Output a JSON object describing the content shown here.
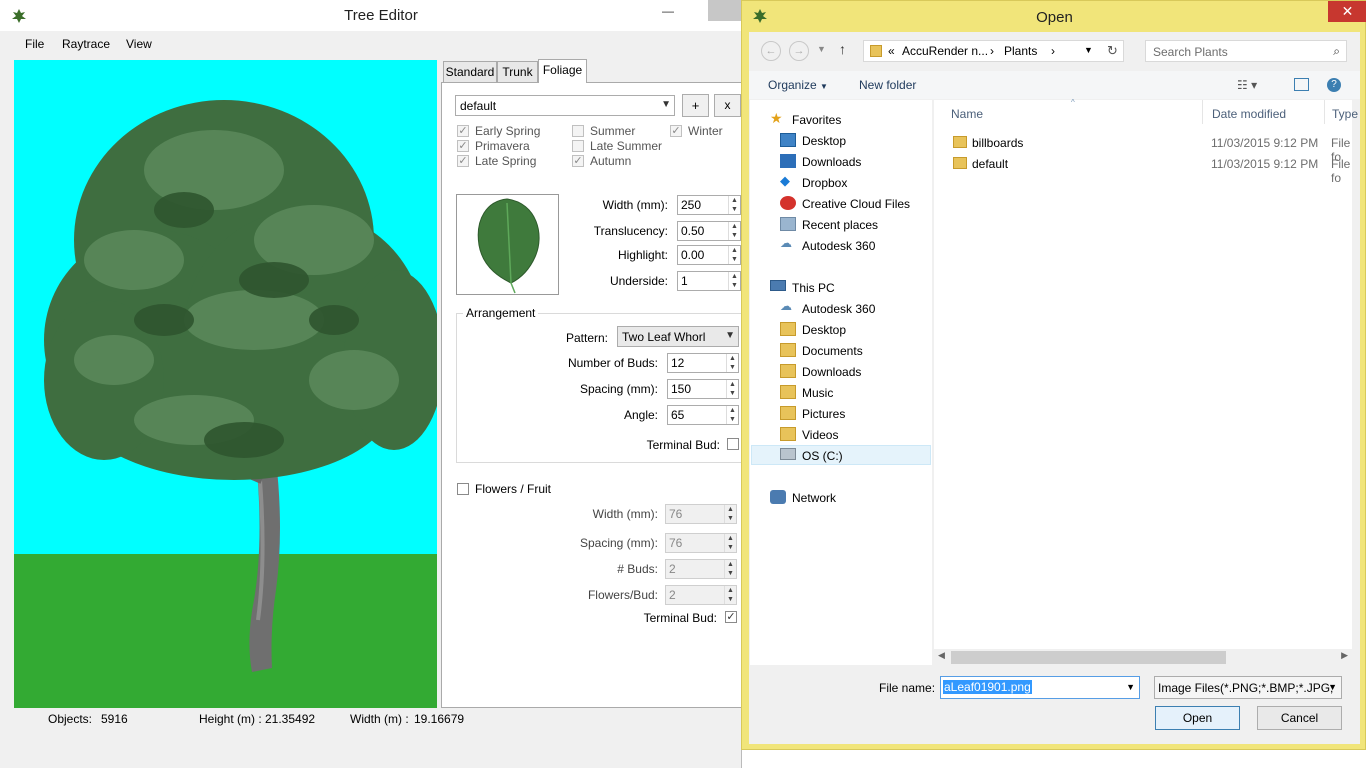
{
  "tree_editor": {
    "title": "Tree Editor",
    "menu": [
      {
        "label": "File"
      },
      {
        "label": "Raytrace"
      },
      {
        "label": "View"
      }
    ],
    "status": {
      "objects_label": "Objects:",
      "objects_value": "5916",
      "height_label": "Height (m) :",
      "height_value": "21.35492",
      "width_label": "Width (m) :",
      "width_value": "19.16679"
    },
    "tabs": [
      "Standard",
      "Trunk",
      "Foliage"
    ],
    "active_tab": "Foliage",
    "foliage": {
      "preset": "default",
      "add_label": "+",
      "remove_label": "x",
      "seasons": [
        {
          "label": "Early Spring",
          "checked": true
        },
        {
          "label": "Primavera",
          "checked": true
        },
        {
          "label": "Late Spring",
          "checked": true
        },
        {
          "label": "Summer",
          "checked": false
        },
        {
          "label": "Late Summer",
          "checked": false
        },
        {
          "label": "Autumn",
          "checked": true
        },
        {
          "label": "Winter",
          "checked": true
        }
      ],
      "leaf": {
        "width_label": "Width (mm):",
        "width_value": "250",
        "translucency_label": "Translucency:",
        "translucency_value": "0.50",
        "highlight_label": "Highlight:",
        "highlight_value": "0.00",
        "underside_label": "Underside:",
        "underside_value": "1"
      },
      "arrangement": {
        "title": "Arrangement",
        "pattern_label": "Pattern:",
        "pattern_value": "Two Leaf Whorl",
        "buds_label": "Number of Buds:",
        "buds_value": "12",
        "spacing_label": "Spacing (mm):",
        "spacing_value": "150",
        "angle_label": "Angle:",
        "angle_value": "65",
        "terminal_label": "Terminal Bud:",
        "terminal_checked": false
      },
      "flowers": {
        "label": "Flowers / Fruit",
        "checked": false,
        "width_label": "Width (mm):",
        "width_value": "76",
        "spacing_label": "Spacing (mm):",
        "spacing_value": "76",
        "buds_label": "# Buds:",
        "buds_value": "2",
        "per_bud_label": "Flowers/Bud:",
        "per_bud_value": "2",
        "terminal_label": "Terminal Bud:",
        "terminal_checked": true
      }
    }
  },
  "open_dialog": {
    "title": "Open",
    "address": {
      "prefix": "«",
      "segment1": "AccuRender n...",
      "sep": "›",
      "segment2": "Plants",
      "sep2": "›"
    },
    "search_placeholder": "Search Plants",
    "toolbar": {
      "organize": "Organize",
      "new_folder": "New folder"
    },
    "nav": {
      "favorites_header": "Favorites",
      "favorites": [
        "Desktop",
        "Downloads",
        "Dropbox",
        "Creative Cloud Files",
        "Recent places",
        "Autodesk 360"
      ],
      "thispc_header": "This PC",
      "thispc": [
        "Autodesk 360",
        "Desktop",
        "Documents",
        "Downloads",
        "Music",
        "Pictures",
        "Videos",
        "OS (C:)"
      ],
      "network": "Network"
    },
    "columns": {
      "name": "Name",
      "date": "Date modified",
      "type": "Type"
    },
    "files": [
      {
        "name": "billboards",
        "date": "11/03/2015 9:12 PM",
        "type": "File fo"
      },
      {
        "name": "default",
        "date": "11/03/2015 9:12 PM",
        "type": "File fo"
      }
    ],
    "filename_label": "File name:",
    "filename_value": "aLeaf01901.png",
    "filetype_value": "Image Files(*.PNG;*.BMP;*.JPG;",
    "open_label": "Open",
    "cancel_label": "Cancel"
  },
  "colors": {
    "sky": "#00ffff",
    "grass": "#33aa33",
    "foliage": "#3e6b3e",
    "dialog_frame": "#f1e57a",
    "close_red": "#c7372f"
  }
}
